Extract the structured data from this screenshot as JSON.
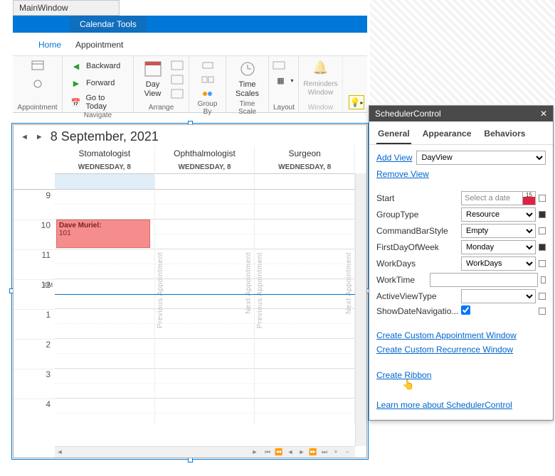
{
  "window": {
    "title": "MainWindow",
    "context_tab": "Calendar Tools"
  },
  "ribbon": {
    "tabs": [
      "Home",
      "Appointment"
    ],
    "active_tab": "Home",
    "navigate": {
      "backward": "Backward",
      "forward": "Forward",
      "today": "Go to Today",
      "label": "Navigate"
    },
    "appointment_label": "Appointment",
    "dayview": "Day View",
    "arrange_label": "Arrange",
    "groupby_label": "Group By",
    "timescales": "Time Scales",
    "timescale_label": "Time Scale",
    "layout_label": "Layout",
    "reminders": "Reminders Window",
    "window_label": "Window"
  },
  "calendar": {
    "date_title": "8 September, 2021",
    "resources": [
      "Stomatologist",
      "Ophthalmologist",
      "Surgeon"
    ],
    "day_label": "WEDNESDAY, 8",
    "hours": [
      "9",
      "10",
      "11",
      "12",
      "1",
      "2",
      "3",
      "4"
    ],
    "pm_marker": "PM",
    "appt": {
      "subject": "Dave Muriel:",
      "location": "101"
    },
    "prev_appt": "Previous Appointment",
    "next_appt": "Next Appointment"
  },
  "panel": {
    "title": "SchedulerControl",
    "tabs": [
      "General",
      "Appearance",
      "Behaviors"
    ],
    "active_tab": "General",
    "add_view": "Add View",
    "add_view_value": "DayView",
    "remove_view": "Remove View",
    "props": {
      "start": {
        "label": "Start",
        "placeholder": "Select a date"
      },
      "group_type": {
        "label": "GroupType",
        "value": "Resource"
      },
      "cmd_bar": {
        "label": "CommandBarStyle",
        "value": "Empty"
      },
      "first_day": {
        "label": "FirstDayOfWeek",
        "value": "Monday"
      },
      "work_days": {
        "label": "WorkDays",
        "value": "WorkDays"
      },
      "work_time": {
        "label": "WorkTime",
        "value": ""
      },
      "active_view": {
        "label": "ActiveViewType",
        "value": ""
      },
      "show_nav": {
        "label": "ShowDateNavigatio..."
      }
    },
    "links": {
      "appt_window": "Create Custom Appointment Window",
      "recur_window": "Create Custom Recurrence Window",
      "ribbon": "Create Ribbon",
      "learn": "Learn more about SchedulerControl"
    }
  }
}
